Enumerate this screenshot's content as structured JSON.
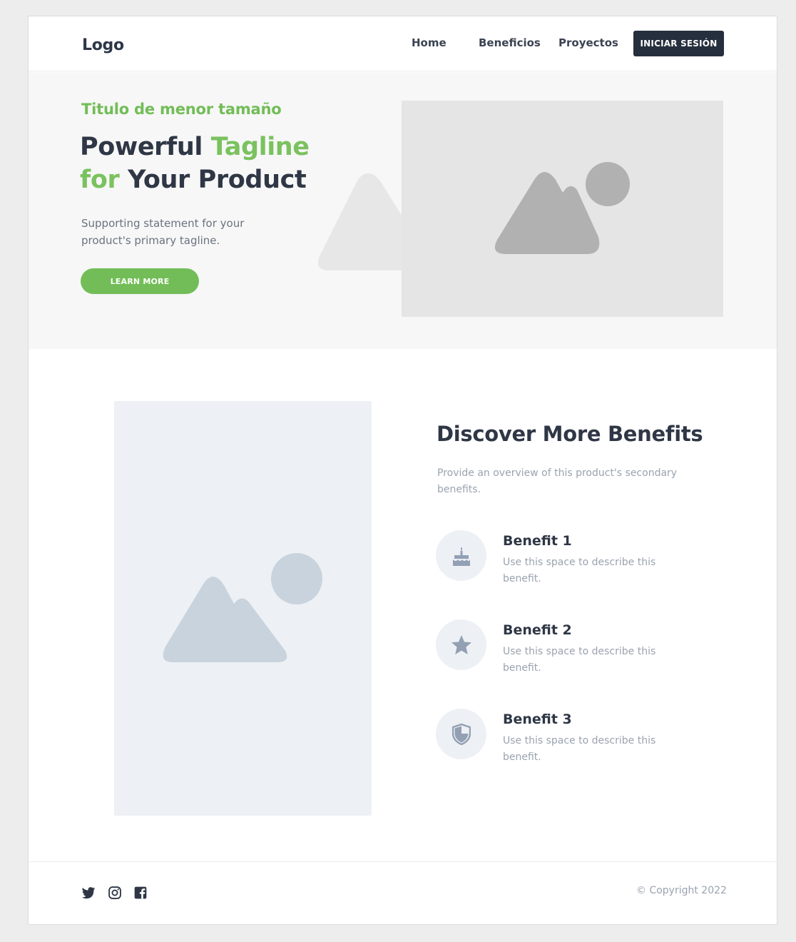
{
  "header": {
    "logo": "Logo",
    "nav": [
      "Home",
      "Beneficios",
      "Proyectos"
    ],
    "login_label": "INICIAR SESIÓN"
  },
  "hero": {
    "eyebrow": "Titulo de menor tamaño",
    "title_part1": "Powerful ",
    "title_accent1": "Tagline",
    "title_accent2": "for",
    "title_part2": " Your Product",
    "subtitle": "Supporting statement for your product's primary tagline.",
    "button_label": "LEARN MORE"
  },
  "benefits": {
    "title": "Discover More Benefits",
    "subtitle": "Provide an overview of this product's secondary benefits.",
    "items": [
      {
        "title": "Benefit 1",
        "description": "Use this space to describe this benefit.",
        "icon": "cake-icon"
      },
      {
        "title": "Benefit 2",
        "description": "Use this space to describe this benefit.",
        "icon": "star-icon"
      },
      {
        "title": "Benefit 3",
        "description": "Use this space to describe this benefit.",
        "icon": "shield-icon"
      }
    ]
  },
  "footer": {
    "social": [
      "twitter-icon",
      "instagram-icon",
      "facebook-icon"
    ],
    "copyright": "© Copyright 2022"
  },
  "colors": {
    "accent_green": "#72bd57",
    "dark_button": "#262f3d",
    "text_dark": "#2f3746",
    "text_muted": "#9aa3af"
  }
}
